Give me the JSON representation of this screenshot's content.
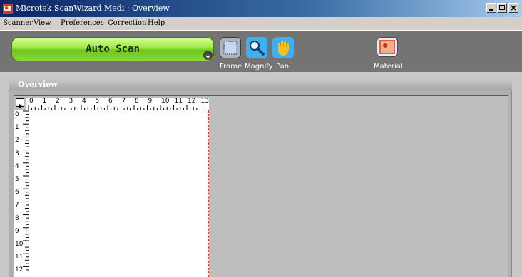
{
  "window": {
    "title": "Microtek ScanWizard Medi : Overview"
  },
  "menu": [
    "Scanner",
    "View",
    "Preferences",
    "Correction",
    "Help"
  ],
  "toolbar": {
    "auto_scan_label": "Auto Scan",
    "tools": [
      {
        "label": "Frame",
        "icon": "frame-icon"
      },
      {
        "label": "Magnify",
        "icon": "magnify-icon"
      },
      {
        "label": "Pan",
        "icon": "pan-hand-icon"
      }
    ],
    "material_label": "Material",
    "colors": {
      "auto_scan_green": "#9be842",
      "toolbar_bg": "#747474"
    }
  },
  "overview": {
    "title": "Overview",
    "h_ruler_labels": [
      "0",
      "1",
      "2",
      "3",
      "4",
      "5",
      "6",
      "7",
      "8",
      "9",
      "10",
      "11",
      "12",
      "13"
    ],
    "v_ruler_labels": [
      "0",
      "1",
      "2",
      "3",
      "4",
      "5",
      "6",
      "7",
      "8",
      "9",
      "10",
      "11",
      "12"
    ]
  }
}
